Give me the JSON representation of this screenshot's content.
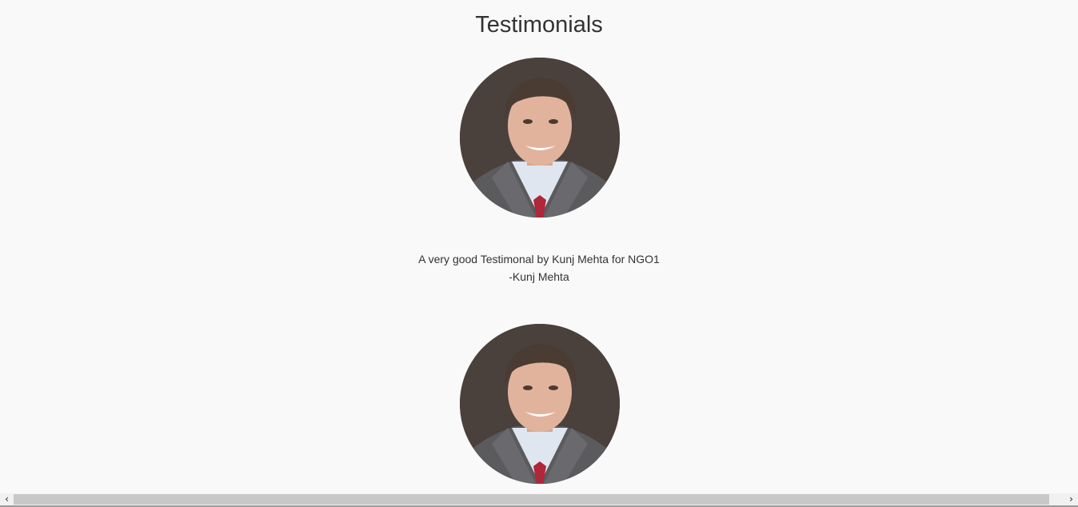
{
  "section": {
    "title": "Testimonials"
  },
  "testimonials": [
    {
      "avatar_icon": "person-portrait",
      "text": "A very good Testimonal by Kunj Mehta for NGO1",
      "author": "-Kunj Mehta"
    },
    {
      "avatar_icon": "person-portrait"
    }
  ],
  "scrollbar": {
    "left_arrow": "‹",
    "right_arrow": "›"
  },
  "colors": {
    "background": "#f9f9f9",
    "text": "#333333",
    "avatar_bg": "#4a403c",
    "tie": "#b0263a"
  }
}
